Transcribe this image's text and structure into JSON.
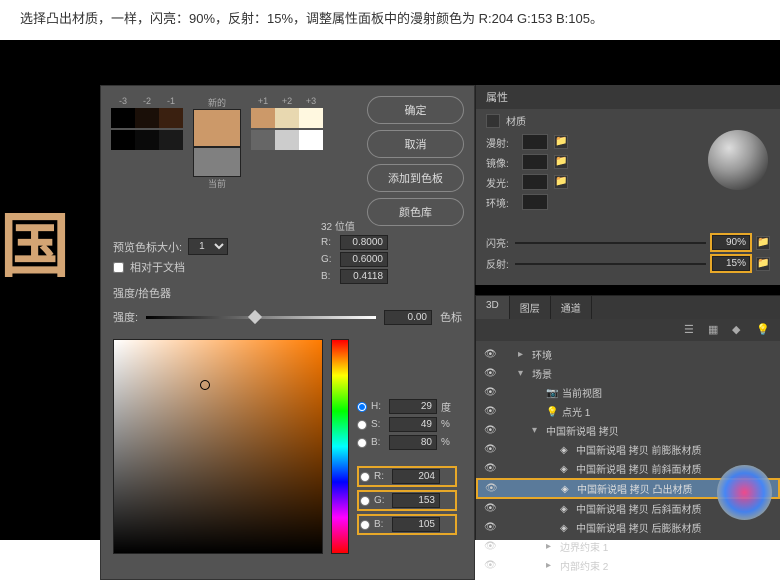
{
  "instruction": "选择凸出材质，一样，闪亮：90%，反射：15%，调整属性面板中的漫射颜色为 R:204 G:153 B:105。",
  "color_picker": {
    "labels": {
      "new": "新的",
      "current": "当前"
    },
    "scale": [
      "-3",
      "-2",
      "-1",
      "",
      "+1",
      "+2",
      "+3"
    ],
    "buttons": {
      "ok": "确定",
      "cancel": "取消",
      "add_swatch": "添加到色板",
      "library": "颜色库"
    },
    "preview_size_label": "预览色标大小:",
    "preview_size_value": "1",
    "relative_doc": "相对于文档",
    "bits_title": "32 位值",
    "bits": {
      "r": "0.8000",
      "g": "0.6000",
      "b": "0.4118"
    },
    "intensity_label": "强度/拾色器",
    "intensity_row": {
      "label": "强度:",
      "value": "0.00",
      "unit": "色标"
    },
    "hsb": {
      "h": {
        "label": "H:",
        "value": "29",
        "unit": "度"
      },
      "s": {
        "label": "S:",
        "value": "49",
        "unit": "%"
      },
      "b": {
        "label": "B:",
        "value": "80",
        "unit": "%"
      }
    },
    "rgb": {
      "r": {
        "label": "R:",
        "value": "204"
      },
      "g": {
        "label": "G:",
        "value": "153"
      },
      "b": {
        "label": "B:",
        "value": "105"
      }
    },
    "swatch_colors": {
      "new_color": "#cc9969",
      "current_color": "#808080",
      "row1": [
        "#000",
        "#1a0f08",
        "#3a2010",
        "#6a4020",
        "#cc9969",
        "#e8d8b0",
        "#fff8e0"
      ],
      "row2": [
        "#000",
        "#0a0a0a",
        "#1a1a1a",
        "#333",
        "#666",
        "#ccc",
        "#fff"
      ]
    }
  },
  "properties": {
    "title": "属性",
    "subtitle": "材质",
    "rows": {
      "diffuse": "漫射:",
      "specular": "镜像:",
      "glow": "发光:",
      "ambient": "环境:"
    },
    "shine": {
      "label": "闪亮:",
      "value": "90%"
    },
    "reflect": {
      "label": "反射:",
      "value": "15%"
    }
  },
  "layers": {
    "tabs": [
      "3D",
      "图层",
      "通道"
    ],
    "items": [
      {
        "label": "环境",
        "indent": 1,
        "toggle": ">"
      },
      {
        "label": "场景",
        "indent": 1,
        "toggle": "v"
      },
      {
        "label": "当前视图",
        "indent": 2,
        "icon": "camera"
      },
      {
        "label": "点光 1",
        "indent": 2,
        "icon": "light"
      },
      {
        "label": "中国新说唱 拷贝",
        "indent": 2,
        "toggle": "v"
      },
      {
        "label": "中国新说唱 拷贝 前膨胀材质",
        "indent": 3,
        "icon": "mat"
      },
      {
        "label": "中国新说唱 拷贝 前斜面材质",
        "indent": 3,
        "icon": "mat"
      },
      {
        "label": "中国新说唱 拷贝 凸出材质",
        "indent": 3,
        "icon": "mat",
        "sel": true,
        "hl": true
      },
      {
        "label": "中国新说唱 拷贝 后斜面材质",
        "indent": 3,
        "icon": "mat"
      },
      {
        "label": "中国新说唱 拷贝 后膨胀材质",
        "indent": 3,
        "icon": "mat"
      },
      {
        "label": "边界约束 1",
        "indent": 3,
        "toggle": ">"
      },
      {
        "label": "内部约束 2",
        "indent": 3,
        "toggle": ">"
      }
    ]
  }
}
